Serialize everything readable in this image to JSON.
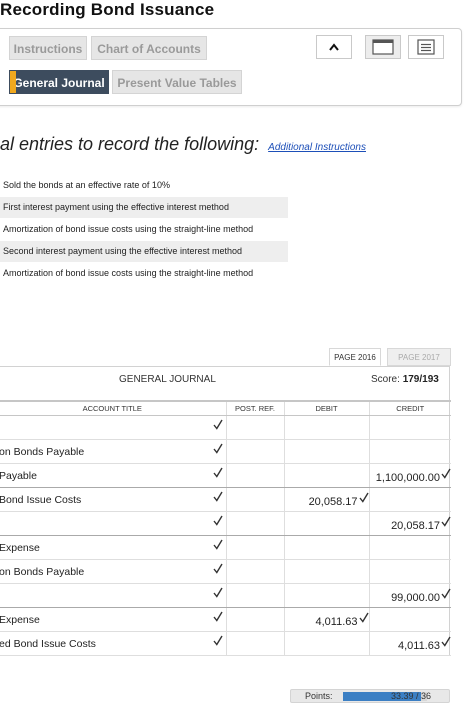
{
  "title": "Recording Bond Issuance",
  "tabs": {
    "instructions": "Instructions",
    "chart_of_accounts": "Chart of Accounts",
    "general_journal": "General Journal",
    "present_value_tables": "Present Value Tables"
  },
  "instructions": {
    "heading": "al entries to record the following:",
    "additional_link": "Additional Instructions",
    "requirements": [
      "Sold the bonds at an effective rate of 10%",
      "First interest payment using the effective interest method",
      "Amortization of bond issue costs using the straight-line method",
      "Second interest payment using the effective interest method",
      "Amortization of bond issue costs using the straight-line method"
    ]
  },
  "pages": {
    "current": "PAGE 2016",
    "next": "PAGE 2017"
  },
  "journal": {
    "title": "GENERAL JOURNAL",
    "score_label": "Score:",
    "score_value": "179/193",
    "columns": {
      "account": "ACCOUNT TITLE",
      "post_ref": "POST. REF.",
      "debit": "DEBIT",
      "credit": "CREDIT"
    },
    "rows": [
      {
        "account": "",
        "debit": "",
        "credit": "",
        "check_acct": true,
        "check_debit": false,
        "check_credit": false,
        "group_end": false
      },
      {
        "account": "on Bonds Payable",
        "debit": "",
        "credit": "",
        "check_acct": true,
        "check_debit": false,
        "check_credit": false,
        "group_end": false
      },
      {
        "account": "Payable",
        "debit": "",
        "credit": "1,100,000.00",
        "check_acct": true,
        "check_debit": false,
        "check_credit": true,
        "group_end": true
      },
      {
        "account": "Bond Issue Costs",
        "debit": "20,058.17",
        "credit": "",
        "check_acct": true,
        "check_debit": true,
        "check_credit": false,
        "group_end": false
      },
      {
        "account": "",
        "debit": "",
        "credit": "20,058.17",
        "check_acct": true,
        "check_debit": false,
        "check_credit": true,
        "group_end": true
      },
      {
        "account": "Expense",
        "debit": "",
        "credit": "",
        "check_acct": true,
        "check_debit": false,
        "check_credit": false,
        "group_end": false
      },
      {
        "account": "on Bonds Payable",
        "debit": "",
        "credit": "",
        "check_acct": true,
        "check_debit": false,
        "check_credit": false,
        "group_end": false
      },
      {
        "account": "",
        "debit": "",
        "credit": "99,000.00",
        "check_acct": true,
        "check_debit": false,
        "check_credit": true,
        "group_end": true
      },
      {
        "account": "Expense",
        "debit": "4,011.63",
        "credit": "",
        "check_acct": true,
        "check_debit": true,
        "check_credit": false,
        "group_end": false
      },
      {
        "account": "ed Bond Issue Costs",
        "debit": "",
        "credit": "4,011.63",
        "check_acct": true,
        "check_debit": false,
        "check_credit": true,
        "group_end": false
      }
    ]
  },
  "points": {
    "label": "Points:",
    "value": "33.39 / 36",
    "fraction": 0.9275
  },
  "colors": {
    "active_tab": "#3d4c5e",
    "tab_marker": "#f0a81e",
    "link": "#1d4fb8",
    "points_fill": "#3b7fc4"
  },
  "icons": {
    "collapse": "chevron-up-icon",
    "window": "window-icon",
    "list": "list-icon",
    "check": "check-icon"
  }
}
